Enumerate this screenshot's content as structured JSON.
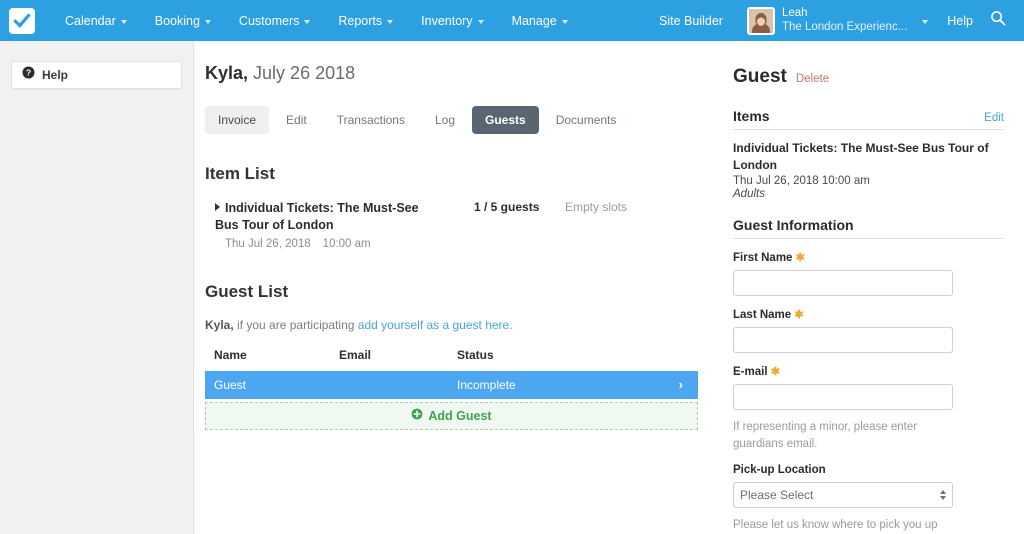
{
  "topnav": {
    "logo_icon": "checkmark-logo",
    "items": [
      {
        "label": "Calendar",
        "has_caret": true
      },
      {
        "label": "Booking",
        "has_caret": true
      },
      {
        "label": "Customers",
        "has_caret": true
      },
      {
        "label": "Reports",
        "has_caret": true
      },
      {
        "label": "Inventory",
        "has_caret": true
      },
      {
        "label": "Manage",
        "has_caret": true
      }
    ],
    "site_builder": "Site Builder",
    "account_name": "Leah",
    "account_org": "The London Experienc...",
    "help": "Help",
    "search_icon": "search-icon",
    "background_color": "#2ca0e0"
  },
  "sidebar": {
    "help_label": "Help",
    "help_icon": "question-circle-icon"
  },
  "main": {
    "title_name": "Kyla,",
    "title_date": "July 26 2018",
    "tabs": [
      {
        "label": "Invoice",
        "state": "soft"
      },
      {
        "label": "Edit",
        "state": "normal"
      },
      {
        "label": "Transactions",
        "state": "normal"
      },
      {
        "label": "Log",
        "state": "normal"
      },
      {
        "label": "Guests",
        "state": "active"
      },
      {
        "label": "Documents",
        "state": "normal"
      }
    ],
    "item_list": {
      "heading": "Item List",
      "item_name": "Individual Tickets: The Must-See Bus Tour of London",
      "item_date": "Thu Jul 26, 2018",
      "item_time": "10:00 am",
      "count": "1 / 5 guests",
      "empty": "Empty slots"
    },
    "guest_list": {
      "heading": "Guest List",
      "note_prefix": "Kyla,",
      "note_text": "if you are participating",
      "note_link": "add yourself as a guest here.",
      "columns": [
        "Name",
        "Email",
        "Status"
      ],
      "rows": [
        {
          "name": "Guest",
          "email": "",
          "status": "Incomplete",
          "chevron": "›"
        }
      ],
      "add_label": "Add Guest",
      "add_icon": "plus-circle-icon",
      "selected_row_color": "#4da6f0"
    }
  },
  "right_panel": {
    "title": "Guest",
    "delete_label": "Delete",
    "delete_color": "#c4786c",
    "items_section": {
      "title": "Items",
      "edit_label": "Edit",
      "item_name": "Individual Tickets: The Must-See Bus Tour of London",
      "item_datetime": "Thu Jul 26, 2018 10:00 am",
      "item_type": "Adults"
    },
    "guest_information": {
      "title": "Guest Information",
      "first_name": {
        "label": "First Name",
        "required": "✱",
        "value": "",
        "placeholder": ""
      },
      "last_name": {
        "label": "Last Name",
        "required": "✱",
        "value": "",
        "placeholder": ""
      },
      "email": {
        "label": "E-mail",
        "required": "✱",
        "value": "",
        "placeholder": ""
      },
      "email_hint": "If representing a minor, please enter guardians email.",
      "pickup": {
        "label": "Pick-up Location",
        "selected": "Please Select",
        "options": [
          "Please Select"
        ]
      },
      "pickup_hint": "Please let us know where to pick you up"
    }
  }
}
